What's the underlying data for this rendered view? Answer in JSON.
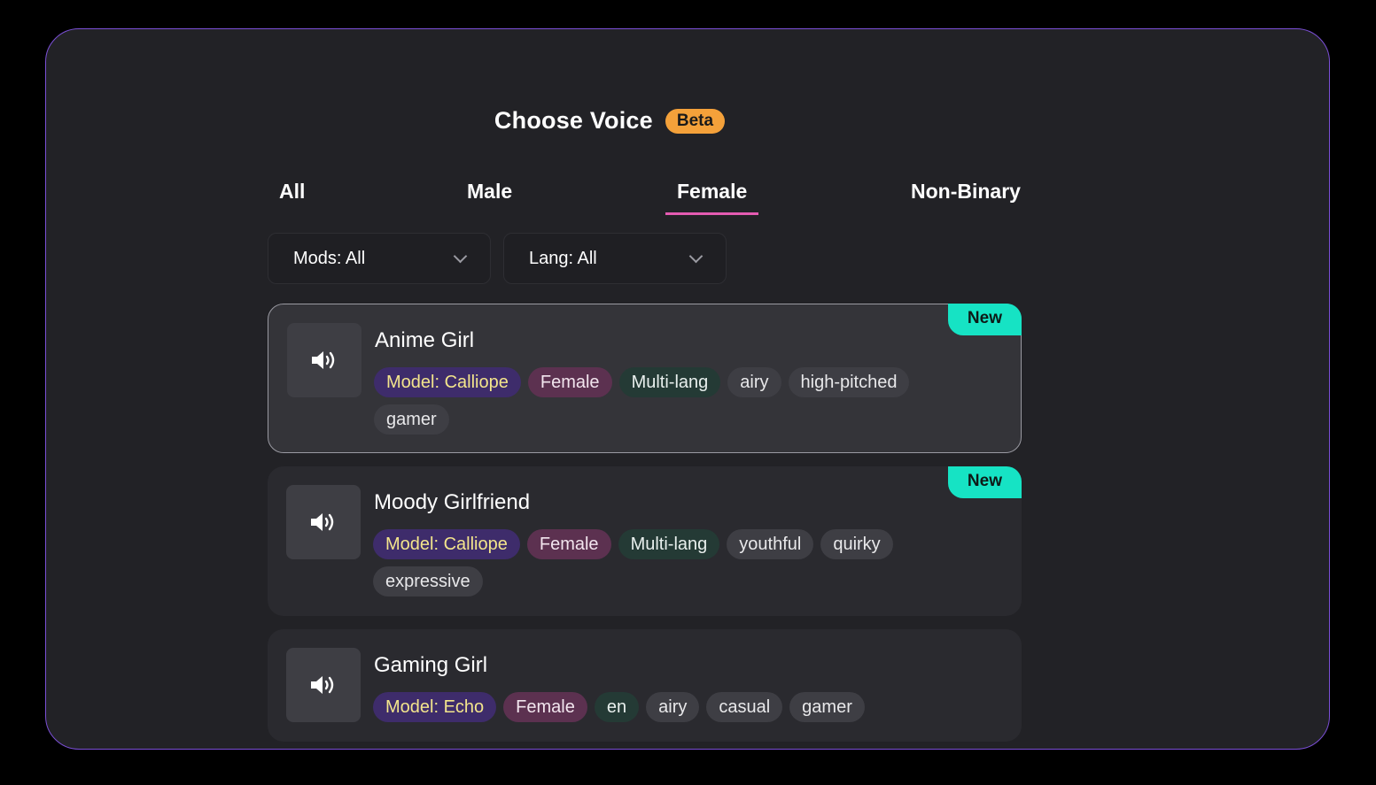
{
  "header": {
    "title": "Choose Voice",
    "badge": "Beta"
  },
  "tabs": [
    {
      "label": "All",
      "active": false
    },
    {
      "label": "Male",
      "active": false
    },
    {
      "label": "Female",
      "active": true
    },
    {
      "label": "Non-Binary",
      "active": false
    }
  ],
  "filters": {
    "mods": "Mods: All",
    "lang": "Lang: All"
  },
  "voices": [
    {
      "name": "Anime Girl",
      "selected": true,
      "badge": "New",
      "tags": {
        "model": "Model: Calliope",
        "gender": "Female",
        "lang": "Multi-lang",
        "t1": "airy",
        "t2": "high-pitched",
        "t3": "gamer"
      }
    },
    {
      "name": "Moody Girlfriend",
      "selected": false,
      "badge": "New",
      "tags": {
        "model": "Model: Calliope",
        "gender": "Female",
        "lang": "Multi-lang",
        "t1": "youthful",
        "t2": "quirky",
        "t3": "expressive"
      }
    },
    {
      "name": "Gaming Girl",
      "selected": false,
      "badge": "",
      "tags": {
        "model": "Model: Echo",
        "gender": "Female",
        "lang": "en",
        "t1": "airy",
        "t2": "casual",
        "t3": "gamer"
      }
    }
  ],
  "icons": {
    "play": "speaker-icon"
  },
  "colors": {
    "border_accent": "#7b4fd6",
    "tab_active_underline": "#e45bb1",
    "beta_badge": "#f4a13a",
    "new_badge": "#16e3c4",
    "model_tag_text": "#f3e58c"
  }
}
